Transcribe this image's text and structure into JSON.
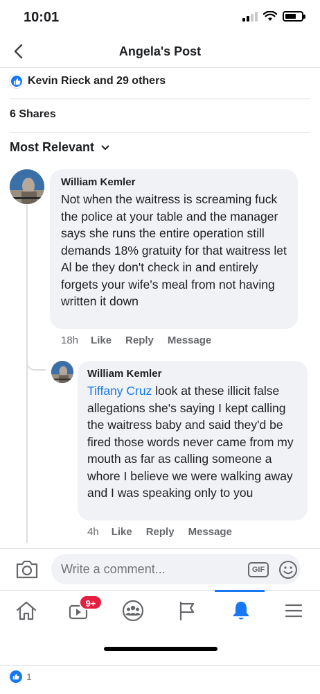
{
  "status_bar": {
    "time": "10:01"
  },
  "header": {
    "title": "Angela's Post"
  },
  "post_stats": {
    "reactions_text": "Kevin Rieck and 29 others",
    "shares_text": "6 Shares"
  },
  "sort": {
    "label": "Most Relevant"
  },
  "comments": [
    {
      "author": "William Kemler",
      "text": "Not when the waitress is screaming fuck the police at your table and the manager says she runs the entire operation still demands 18% gratuity for that waitress  let Al be they don't check in and entirely forgets your wife's meal from not having written it down",
      "time": "18h",
      "actions": [
        "Like",
        "Reply",
        "Message"
      ]
    },
    {
      "author": "William Kemler",
      "mention": "Tiffany Cruz",
      "text": " look at these illicit false allegations she's saying I kept calling the waitress baby and said they'd be fired those words never came from my mouth as far as calling someone a whore I believe we were walking away and I was speaking only to you",
      "time": "4h",
      "actions": [
        "Like",
        "Reply",
        "Message"
      ]
    }
  ],
  "composer": {
    "placeholder": "Write a comment...",
    "gif_label": "GIF"
  },
  "tab_bar": {
    "video_badge": "9+",
    "active_tab": "notifications"
  },
  "footer": {
    "likes_count": "1"
  },
  "colors": {
    "accent": "#1877f2",
    "badge": "#e41e3f",
    "bubble": "#f0f2f5"
  },
  "icons": [
    "back-chevron-icon",
    "like-icon",
    "chevron-down-icon",
    "camera-icon",
    "gif-icon",
    "smiley-icon",
    "home-icon",
    "video-icon",
    "groups-icon",
    "flag-icon",
    "bell-icon",
    "menu-icon"
  ]
}
